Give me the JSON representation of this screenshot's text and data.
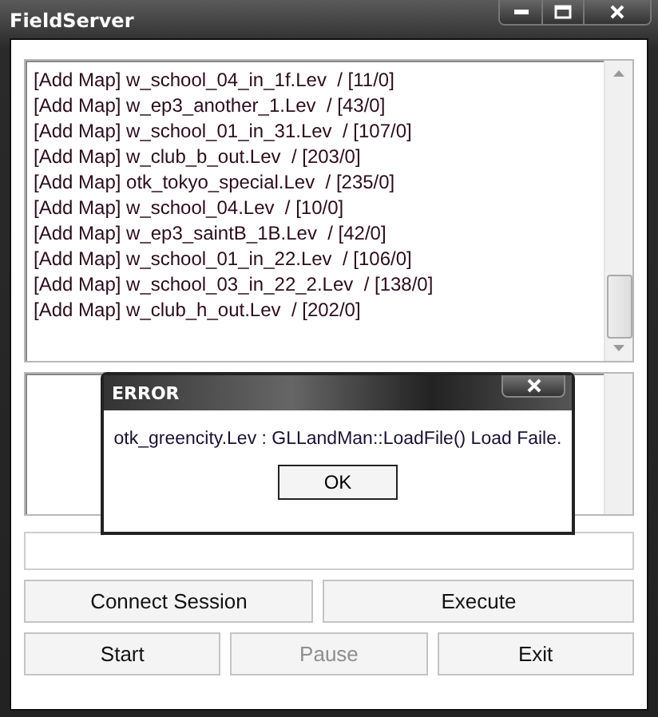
{
  "window": {
    "title": "FieldServer"
  },
  "log": [
    "[Add Map] w_school_04_in_1f.Lev  / [11/0]",
    "[Add Map] w_ep3_another_1.Lev  / [43/0]",
    "[Add Map] w_school_01_in_31.Lev  / [107/0]",
    "[Add Map] w_club_b_out.Lev  / [203/0]",
    "[Add Map] otk_tokyo_special.Lev  / [235/0]",
    "[Add Map] w_school_04.Lev  / [10/0]",
    "[Add Map] w_ep3_saintB_1B.Lev  / [42/0]",
    "[Add Map] w_school_01_in_22.Lev  / [106/0]",
    "[Add Map] w_school_03_in_22_2.Lev  / [138/0]",
    "[Add Map] w_club_h_out.Lev  / [202/0]"
  ],
  "buttons": [
    [
      {
        "label": "Connect Session",
        "disabled": false
      },
      {
        "label": "Execute",
        "disabled": false
      }
    ],
    [
      {
        "label": "Start",
        "disabled": false
      },
      {
        "label": "Pause",
        "disabled": true
      },
      {
        "label": "Exit",
        "disabled": false
      }
    ]
  ],
  "dialog": {
    "title": "ERROR",
    "message": "otk_greencity.Lev : GLLandMan::LoadFile() Load Faile.",
    "button": "OK"
  }
}
